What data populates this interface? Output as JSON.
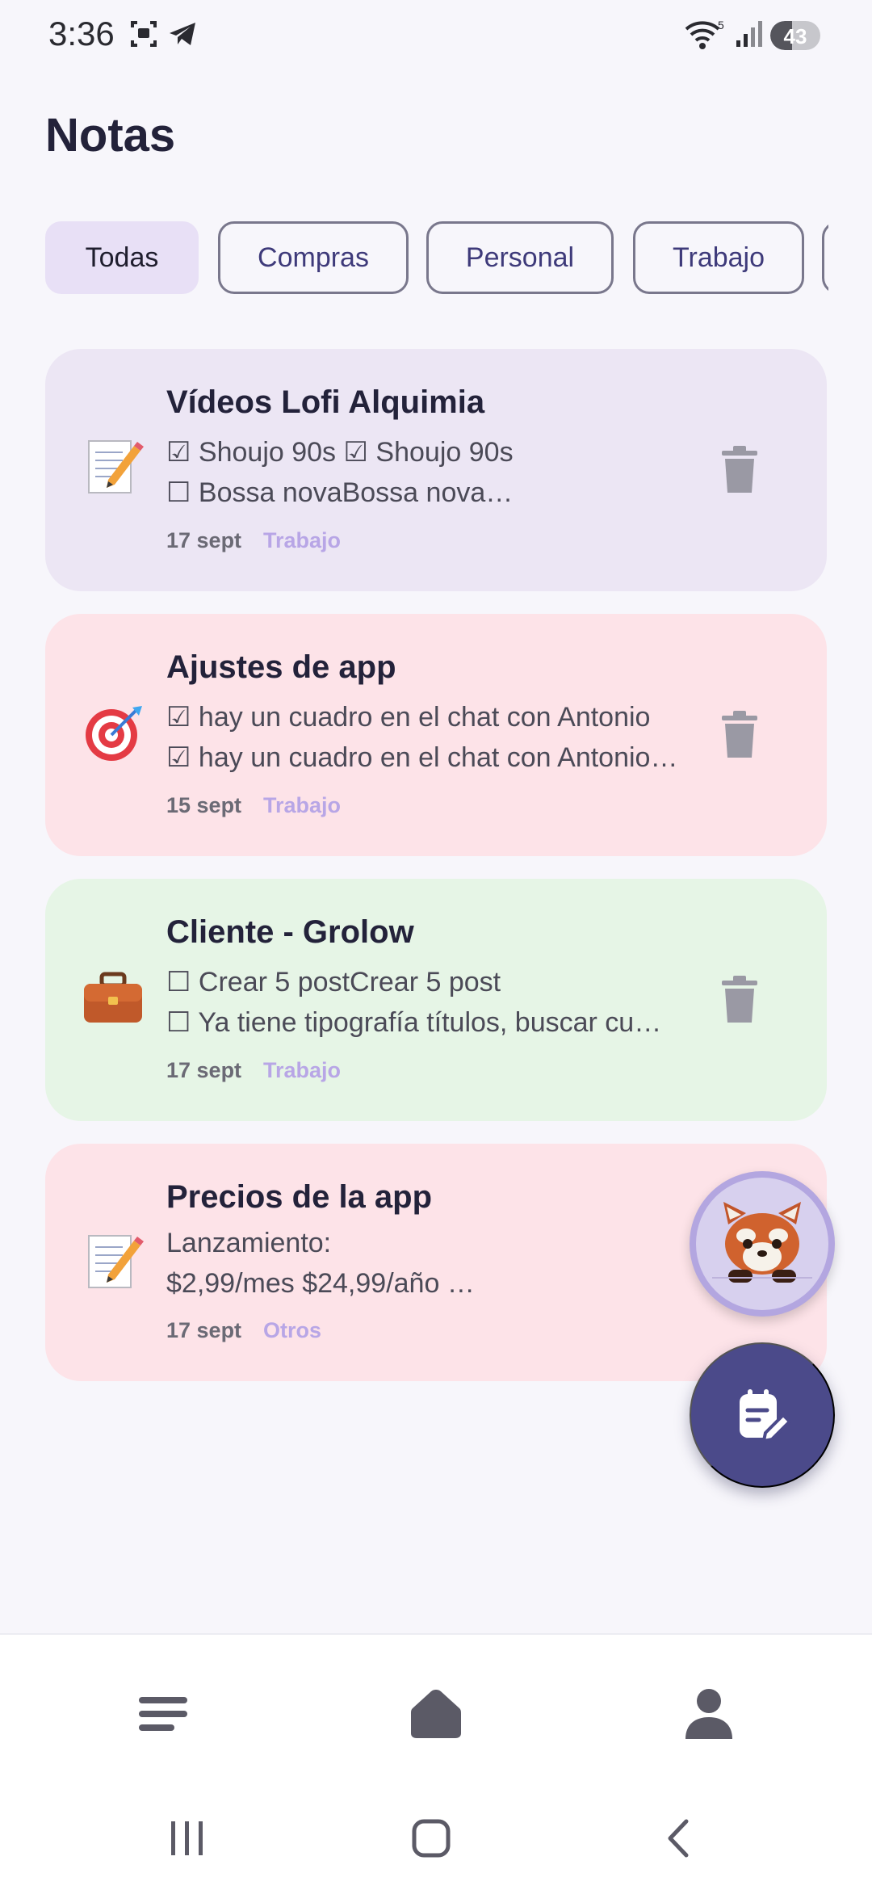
{
  "status_bar": {
    "time": "3:36",
    "battery": "43",
    "battery_level": 0.43,
    "icons": [
      "screenshot-icon",
      "telegram-icon",
      "wifi-icon",
      "signal-icon",
      "battery-icon"
    ]
  },
  "page": {
    "title": "Notas"
  },
  "filters": [
    {
      "label": "Todas",
      "active": true
    },
    {
      "label": "Compras",
      "active": false
    },
    {
      "label": "Personal",
      "active": false
    },
    {
      "label": "Trabajo",
      "active": false
    },
    {
      "label": "",
      "active": false
    }
  ],
  "notes": [
    {
      "icon": "memo-emoji",
      "title": "Vídeos Lofi Alquimia",
      "line1": "☑ Shoujo 90s ☑ Shoujo 90s",
      "line2": "☐ Bossa novaBossa nova…",
      "date": "17 sept",
      "tag": "Trabajo",
      "color": "#ece6f4",
      "deletable": true
    },
    {
      "icon": "target-emoji",
      "title": "Ajustes de app",
      "line1": "☑ hay un cuadro en el chat con Antonio",
      "line2": "☑ hay un cuadro en el chat con Antonio…",
      "date": "15 sept",
      "tag": "Trabajo",
      "color": "#fde3e8",
      "deletable": true
    },
    {
      "icon": "briefcase-emoji",
      "title": "Cliente - Grolow",
      "line1": "☐ Crear 5 postCrear 5 post",
      "line2": "☐ Ya tiene tipografía títulos, buscar cu…",
      "date": "17 sept",
      "tag": "Trabajo",
      "color": "#e6f5e6",
      "deletable": true
    },
    {
      "icon": "memo-emoji",
      "title": "Precios de la app",
      "line1": "Lanzamiento:",
      "line2": "$2,99/mes $24,99/año …",
      "date": "17 sept",
      "tag": "Otros",
      "color": "#fde3e8",
      "deletable": false
    }
  ],
  "fabs": {
    "avatar": "red-panda-avatar",
    "new_note": "new-note-icon"
  },
  "bottom_nav": [
    "menu-icon",
    "home-icon",
    "profile-icon"
  ],
  "system_nav": [
    "recents-icon",
    "home-button-icon",
    "back-icon"
  ],
  "colors": {
    "accent": "#4b4a8a",
    "chip_active": "#e8e0f6",
    "tag": "#b8a6e6"
  }
}
